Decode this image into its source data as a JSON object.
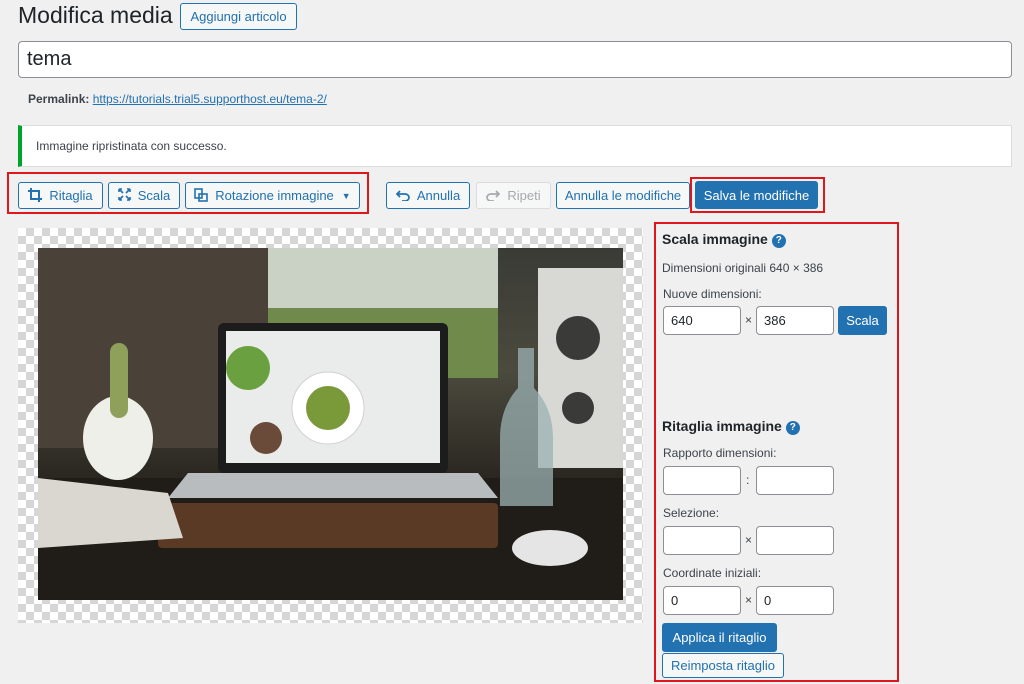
{
  "header": {
    "title": "Modifica media",
    "add_button": "Aggiungi articolo"
  },
  "title_field": {
    "value": "tema"
  },
  "permalink": {
    "label": "Permalink:",
    "url": "https://tutorials.trial5.supporthost.eu/tema-2/"
  },
  "notice": {
    "text": "Immagine ripristinata con successo.",
    "color": "#00a32a"
  },
  "toolbar": {
    "crop": "Ritaglia",
    "scale": "Scala",
    "rotate": "Rotazione immagine",
    "undo": "Annulla",
    "redo": "Ripeti",
    "cancel": "Annulla le modifiche",
    "save": "Salva le modifiche"
  },
  "scale_panel": {
    "title": "Scala immagine",
    "original": "Dimensioni originali 640 × 386",
    "new_label": "Nuove dimensioni:",
    "width": "640",
    "height": "386",
    "times": "×",
    "button": "Scala"
  },
  "crop_panel": {
    "title": "Ritaglia immagine",
    "ratio_label": "Rapporto dimensioni:",
    "ratio_sep": ":",
    "selection_label": "Selezione:",
    "selection_sep": "×",
    "coords_label": "Coordinate iniziali:",
    "coord_x": "0",
    "coord_y": "0",
    "coord_sep": "×",
    "apply": "Applica il ritaglio",
    "reset": "Reimposta ritaglio"
  },
  "colors": {
    "accent": "#2271b1",
    "highlight": "#e0161d"
  }
}
